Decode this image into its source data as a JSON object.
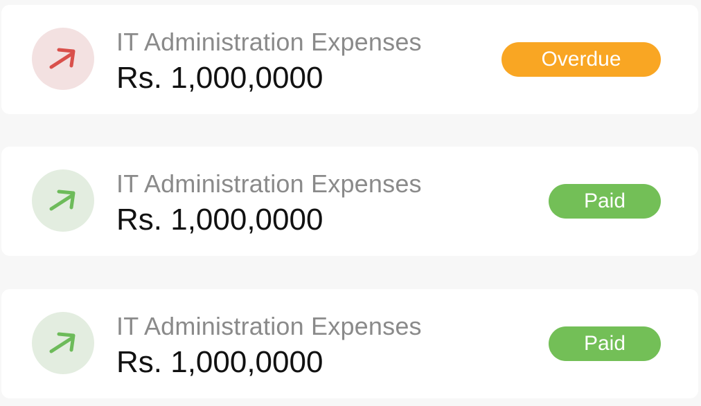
{
  "transactions": [
    {
      "title": "IT Administration Expenses",
      "amount": "Rs. 1,000,0000",
      "status": "Overdue",
      "icon": "arrow-up-right-icon",
      "icon_color": "#d9504b",
      "icon_bg": "#f3e1e1",
      "status_color": "#f9a623"
    },
    {
      "title": "IT Administration Expenses",
      "amount": "Rs. 1,000,0000",
      "status": "Paid",
      "icon": "arrow-up-right-icon",
      "icon_color": "#6dbb5a",
      "icon_bg": "#e3ede0",
      "status_color": "#73bf57"
    },
    {
      "title": "IT Administration Expenses",
      "amount": "Rs. 1,000,0000",
      "status": "Paid",
      "icon": "arrow-up-right-icon",
      "icon_color": "#6dbb5a",
      "icon_bg": "#e3ede0",
      "status_color": "#73bf57"
    }
  ]
}
